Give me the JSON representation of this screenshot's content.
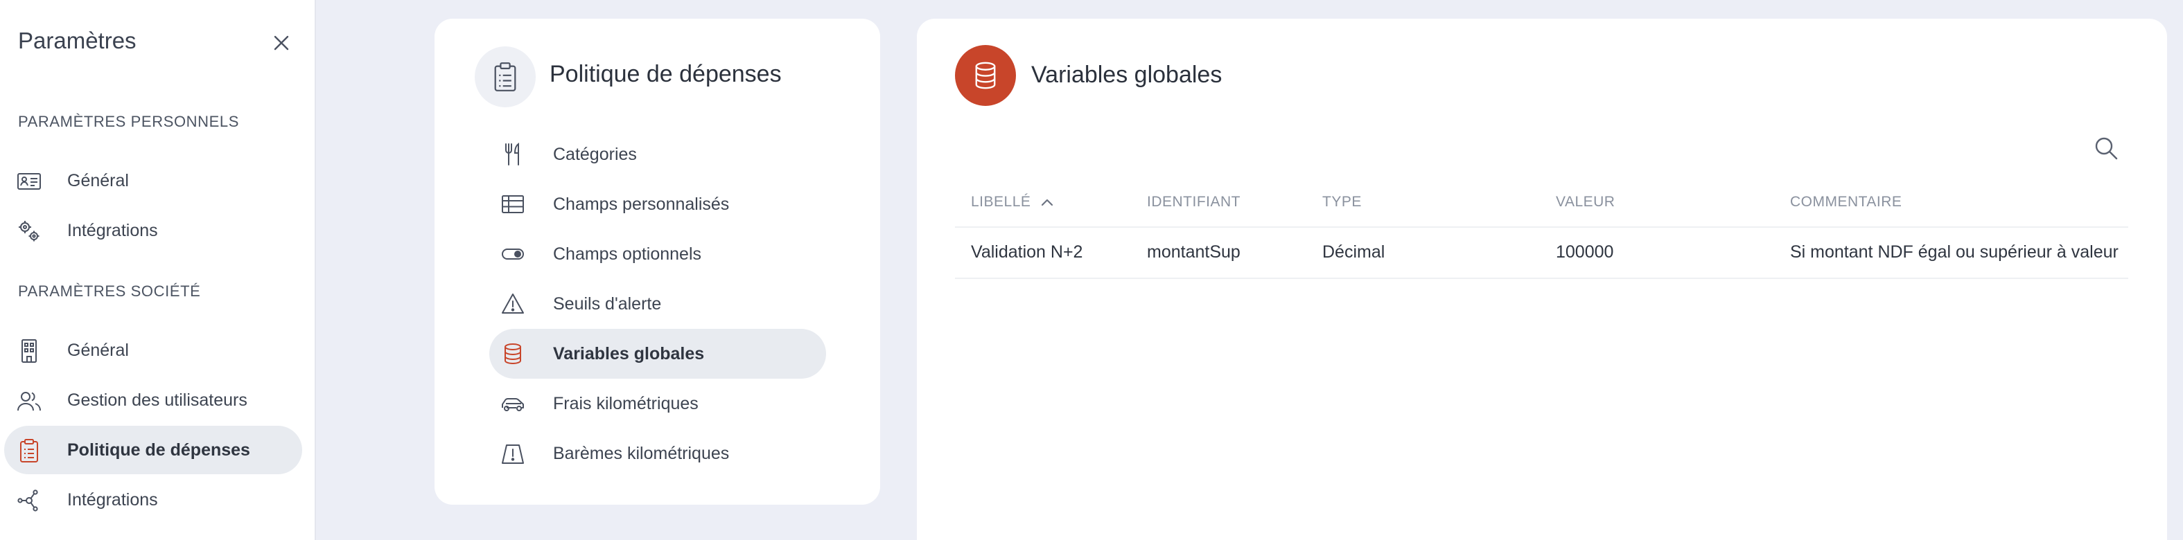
{
  "sidebar": {
    "title": "Paramètres",
    "personal_section": "PARAMÈTRES PERSONNELS",
    "personal_items": [
      {
        "label": "Général",
        "icon": "id-card-icon"
      },
      {
        "label": "Intégrations",
        "icon": "gears-icon"
      }
    ],
    "company_section": "PARAMÈTRES SOCIÉTÉ",
    "company_items": [
      {
        "label": "Général",
        "icon": "building-icon"
      },
      {
        "label": "Gestion des utilisateurs",
        "icon": "users-icon"
      },
      {
        "label": "Politique de dépenses",
        "icon": "clipboard-icon",
        "active": true
      },
      {
        "label": "Intégrations",
        "icon": "network-icon"
      }
    ]
  },
  "policy_nav": {
    "title": "Politique de dépenses",
    "items": [
      {
        "label": "Catégories",
        "icon": "cutlery-icon"
      },
      {
        "label": "Champs personnalisés",
        "icon": "table-icon"
      },
      {
        "label": "Champs optionnels",
        "icon": "toggle-icon"
      },
      {
        "label": "Seuils d'alerte",
        "icon": "warning-icon"
      },
      {
        "label": "Variables globales",
        "icon": "database-icon",
        "active": true
      },
      {
        "label": "Frais kilométriques",
        "icon": "car-icon"
      },
      {
        "label": "Barèmes kilométriques",
        "icon": "road-warning-icon"
      }
    ]
  },
  "main": {
    "title": "Variables globales",
    "columns": [
      "LIBELLÉ",
      "IDENTIFIANT",
      "TYPE",
      "VALEUR",
      "COMMENTAIRE"
    ],
    "rows": [
      [
        "Validation N+2",
        "montantSup",
        "Décimal",
        "100000",
        "Si montant NDF égal ou supérieur à valeur"
      ]
    ]
  },
  "colors": {
    "accent": "#c8452a",
    "active_bg": "#e8ebf0",
    "page_bg": "#eceef6"
  }
}
